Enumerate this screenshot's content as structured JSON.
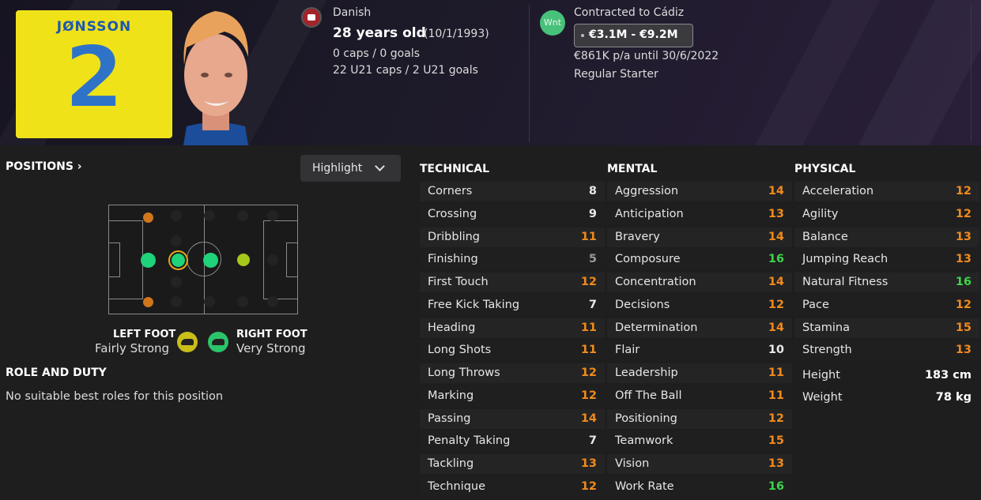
{
  "player": {
    "shirt_name": "JØNSSON",
    "shirt_number": "2",
    "nationality": "Danish",
    "age": "28 years old",
    "dob": "(10/1/1993)",
    "caps": "0 caps / 0 goals",
    "u21": "22 U21 caps / 2 U21 goals",
    "nation_icon": "denmark-flag-icon"
  },
  "contract": {
    "status": "Contracted to Cádiz",
    "badge": "Wnt",
    "value_range": "€3.1M - €9.2M",
    "wage": "€861K p/a until 30/6/2022",
    "role": "Regular Starter"
  },
  "positions": {
    "title": "POSITIONS",
    "highlight_label": "Highlight",
    "left_foot_label": "LEFT FOOT",
    "left_foot_value": "Fairly Strong",
    "right_foot_label": "RIGHT FOOT",
    "right_foot_value": "Very Strong",
    "colors": {
      "natural": "#1fd37a",
      "accomplished": "#a6c81a",
      "awkward": "#d0761c",
      "left_foot": "#c9bd1a",
      "right_foot": "#2bc46a"
    }
  },
  "role": {
    "title": "ROLE AND DUTY",
    "text": "No suitable best roles for this position"
  },
  "attribute_colors": {
    "low": "#9a9a9a",
    "mid": "#e8e8e8",
    "good": "#f08a1c",
    "high": "#3fd34a"
  },
  "technical": {
    "title": "TECHNICAL",
    "rows": [
      {
        "name": "Corners",
        "value": "8"
      },
      {
        "name": "Crossing",
        "value": "9"
      },
      {
        "name": "Dribbling",
        "value": "11"
      },
      {
        "name": "Finishing",
        "value": "5"
      },
      {
        "name": "First Touch",
        "value": "12"
      },
      {
        "name": "Free Kick Taking",
        "value": "7"
      },
      {
        "name": "Heading",
        "value": "11"
      },
      {
        "name": "Long Shots",
        "value": "11"
      },
      {
        "name": "Long Throws",
        "value": "12"
      },
      {
        "name": "Marking",
        "value": "12"
      },
      {
        "name": "Passing",
        "value": "14"
      },
      {
        "name": "Penalty Taking",
        "value": "7"
      },
      {
        "name": "Tackling",
        "value": "13"
      },
      {
        "name": "Technique",
        "value": "12"
      }
    ]
  },
  "mental": {
    "title": "MENTAL",
    "rows": [
      {
        "name": "Aggression",
        "value": "14"
      },
      {
        "name": "Anticipation",
        "value": "13"
      },
      {
        "name": "Bravery",
        "value": "14"
      },
      {
        "name": "Composure",
        "value": "16"
      },
      {
        "name": "Concentration",
        "value": "14"
      },
      {
        "name": "Decisions",
        "value": "12"
      },
      {
        "name": "Determination",
        "value": "14"
      },
      {
        "name": "Flair",
        "value": "10"
      },
      {
        "name": "Leadership",
        "value": "11"
      },
      {
        "name": "Off The Ball",
        "value": "11"
      },
      {
        "name": "Positioning",
        "value": "12"
      },
      {
        "name": "Teamwork",
        "value": "15"
      },
      {
        "name": "Vision",
        "value": "13"
      },
      {
        "name": "Work Rate",
        "value": "16"
      }
    ]
  },
  "physical": {
    "title": "PHYSICAL",
    "rows": [
      {
        "name": "Acceleration",
        "value": "12"
      },
      {
        "name": "Agility",
        "value": "12"
      },
      {
        "name": "Balance",
        "value": "13"
      },
      {
        "name": "Jumping Reach",
        "value": "13"
      },
      {
        "name": "Natural Fitness",
        "value": "16"
      },
      {
        "name": "Pace",
        "value": "12"
      },
      {
        "name": "Stamina",
        "value": "15"
      },
      {
        "name": "Strength",
        "value": "13"
      }
    ],
    "height_label": "Height",
    "height_value": "183 cm",
    "weight_label": "Weight",
    "weight_value": "78 kg"
  }
}
